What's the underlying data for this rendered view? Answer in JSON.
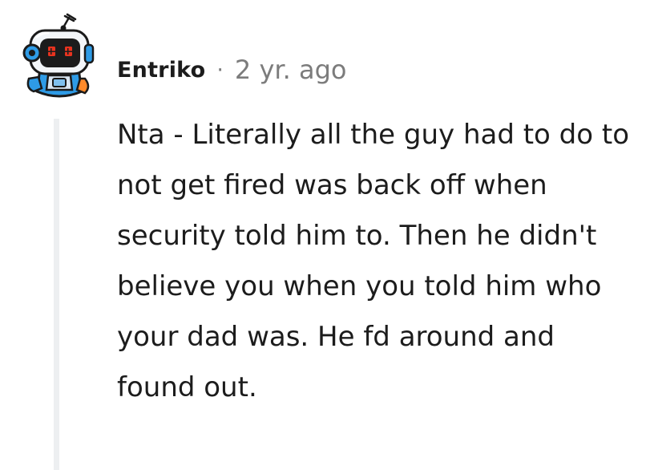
{
  "comment": {
    "username": "Entriko",
    "separator": "·",
    "timestamp": "2 yr. ago",
    "body": "Nta - Literally all the guy had to do to not get fired was back off when security told him to. Then he didn't believe you when you told him who your dad was. He fd around and found out."
  },
  "avatar": {
    "icon": "robot-avatar-icon",
    "eye_color": "#e8331f",
    "accent_color": "#1f8fe0"
  },
  "colors": {
    "text": "#1c1c1c",
    "meta": "#7c7c7c",
    "thread_line": "#edeff1"
  }
}
